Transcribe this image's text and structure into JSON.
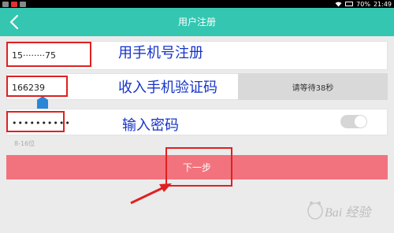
{
  "status_bar": {
    "battery": "70%",
    "time": "21:49"
  },
  "app_bar": {
    "title": "用户注册",
    "back_icon": "chevron-left-icon"
  },
  "form": {
    "phone_value": "15········75",
    "code_value": "166239",
    "wait_button_label": "请等待38秒",
    "password_value": "••••••••••",
    "password_hint": "8-16位",
    "next_button_label": "下一步"
  },
  "annotations": {
    "phone": "用手机号注册",
    "code": "收入手机验证码",
    "password": "输入密码"
  },
  "watermark": {
    "text": "Bai 经验"
  },
  "colors": {
    "app_bar": "#34c6b0",
    "next_button": "#f2737d",
    "annotation_box": "#e02020",
    "annotation_text": "#1533c9"
  }
}
